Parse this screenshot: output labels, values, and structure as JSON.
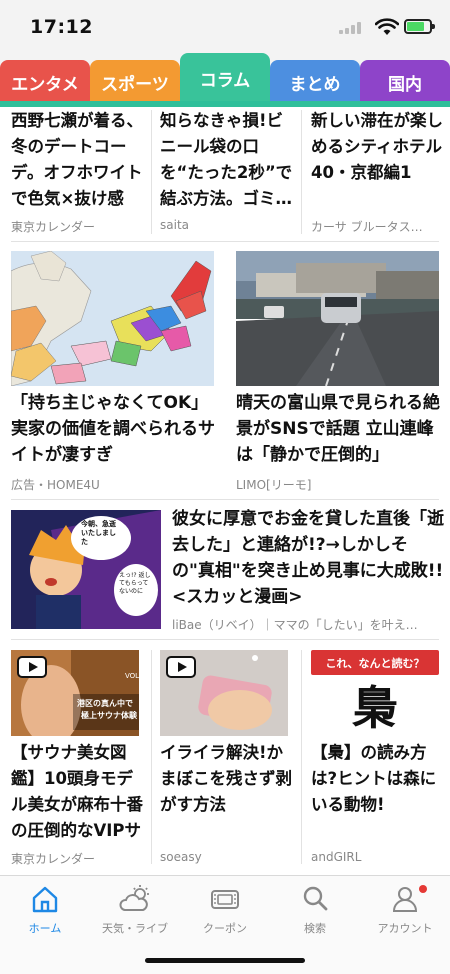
{
  "status": {
    "time": "17:12"
  },
  "tabs": [
    {
      "label": "エンタメ",
      "color": "#e8534b"
    },
    {
      "label": "スポーツ",
      "color": "#f39a32"
    },
    {
      "label": "コラム",
      "color": "#39c39a"
    },
    {
      "label": "まとめ",
      "color": "#4d8fe0"
    },
    {
      "label": "国内",
      "color": "#8e44c9"
    }
  ],
  "active_tab": "コラム",
  "top_row": [
    {
      "title": "西野七瀬が着る、冬のデートコーデ。オフホワイトで色気×抜け感を!",
      "source": "東京カレンダー"
    },
    {
      "title": "知らなきゃ損!ビニール袋の口を“たった2秒”で結ぶ方法。ゴミ…",
      "source": "saita"
    },
    {
      "title": "新しい滞在が楽しめるシティホテル40・京都編1",
      "source": "カーサ ブルータス…"
    }
  ],
  "feature_row": [
    {
      "title": "「持ち主じゃなくてOK」実家の価値を調べられるサイトが凄すぎ",
      "source": "広告・HOME4U"
    },
    {
      "title": "晴天の富山県で見られる絶景がSNSで話題 立山連峰は「静かで圧倒的」",
      "source": "LIMO[リーモ]"
    }
  ],
  "wide_article": {
    "title": "彼女に厚意でお金を貸した直後「逝去した」と連絡が!?→しかしその\"真相\"を突き止め見事に大成敗!!<スカッと漫画>",
    "source": "liBae（リベイ）｜ママの「したい」を叶え…",
    "manga_text_1": "今朝、急逝いたしました",
    "manga_text_2": "えっ!? 返してもらってないのに"
  },
  "bottom_row": [
    {
      "title": "【サウナ美女図鑑】10頭身モデル美女が麻布十番の圧倒的なVIPサウナで…",
      "source": "東京カレンダー",
      "thumb_text_1": "港区の真ん中で",
      "thumb_text_2": "極上サウナ体験",
      "thumb_text_3": "VOL"
    },
    {
      "title": "イライラ解決!かまぼこを残さず剥がす方法",
      "source": "soeasy"
    },
    {
      "title": "【梟】の読み方は?ヒントは森にいる動物!",
      "source": "andGIRL",
      "badge": "これ、なんと読む？",
      "kanji": "梟"
    }
  ],
  "nav": [
    {
      "label": "ホーム",
      "icon": "home-icon"
    },
    {
      "label": "天気・ライブ",
      "icon": "weather-icon"
    },
    {
      "label": "クーポン",
      "icon": "coupon-icon"
    },
    {
      "label": "検索",
      "icon": "search-icon"
    },
    {
      "label": "アカウント",
      "icon": "account-icon"
    }
  ],
  "colors": {
    "accent": "#1e88e5",
    "notify": "#e53935",
    "ad_red": "#d93434"
  }
}
